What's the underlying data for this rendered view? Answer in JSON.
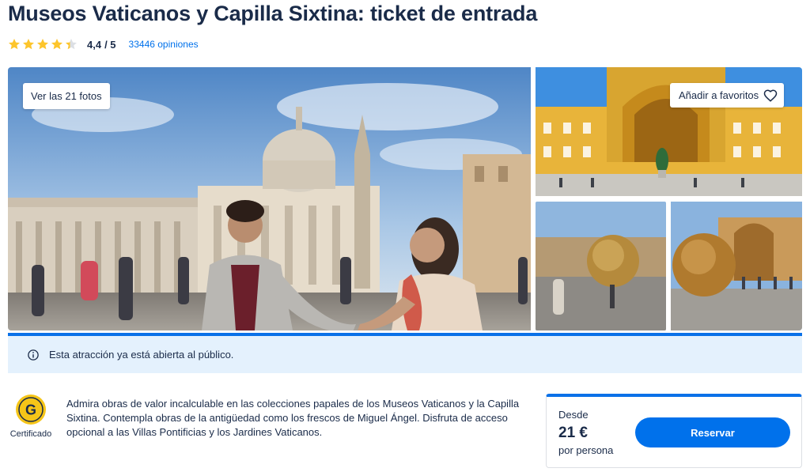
{
  "page": {
    "title": "Museos Vaticanos y Capilla Sixtina: ticket de entrada"
  },
  "rating": {
    "stars_value": 4.4,
    "stars_max": 5,
    "score": "4,4",
    "out_of": "/ 5",
    "reviews_label": "33446 opiniones"
  },
  "gallery": {
    "see_photos_label": "Ver las 21 fotos",
    "favorite_label": "Añadir a favoritos"
  },
  "notice": {
    "text": "Esta atracción ya está abierta al público."
  },
  "badge": {
    "letter": "G",
    "label": "Certificado"
  },
  "description": {
    "text": "Admira obras de valor incalculable en las colecciones papales de los Museos Vaticanos y la Capilla Sixtina. Contempla obras de la antigüedad como los frescos de Miguel Ángel. Disfruta de acceso opcional a las Villas Pontificias y los Jardines Vaticanos."
  },
  "price": {
    "from_label": "Desde",
    "amount": "21 €",
    "per_label": "por persona",
    "reserve_label": "Reservar"
  },
  "colors": {
    "accent": "#0071eb",
    "star": "#fdc52c",
    "notice_bg": "#e4f1fd",
    "text": "#1a2b49"
  },
  "icons": {
    "star": "star-icon",
    "heart": "heart-icon",
    "info": "info-icon",
    "badge": "certified-badge-icon"
  }
}
